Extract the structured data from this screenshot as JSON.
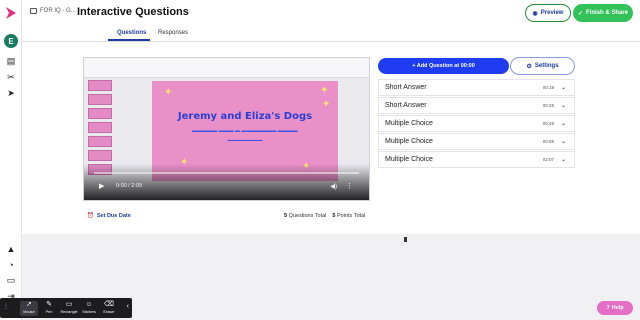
{
  "header": {
    "breadcrumb": "FOR IQ - G...",
    "title": "Interactive Questions",
    "preview_label": "Preview",
    "finish_label": "Finish & Share"
  },
  "user": {
    "avatar_initial": "E"
  },
  "tabs": [
    {
      "label": "Questions",
      "active": true
    },
    {
      "label": "Responses",
      "active": false
    }
  ],
  "video": {
    "slide_title": "Jeremy and Eliza's Dogs",
    "time": "0:00 / 2:09",
    "progress_fraction": 0.0
  },
  "footer": {
    "due_date_label": "Set Due Date",
    "questions_count": "5",
    "questions_label": "Questions Total",
    "points_count": "5",
    "points_label": "Points Total"
  },
  "actions": {
    "add_question_label": "+ Add Question at 00:00",
    "settings_label": "Settings"
  },
  "questions": [
    {
      "label": "Short Answer",
      "time": "00:19"
    },
    {
      "label": "Short Answer",
      "time": "00:28"
    },
    {
      "label": "Multiple Choice",
      "time": "00:49"
    },
    {
      "label": "Multiple Choice",
      "time": "00:59"
    },
    {
      "label": "Multiple Choice",
      "time": "02:07"
    }
  ],
  "toolbar": {
    "tools": [
      {
        "label": "Mouse",
        "icon": "cursor-icon"
      },
      {
        "label": "Pen",
        "icon": "pen-icon"
      },
      {
        "label": "Rectangle",
        "icon": "rectangle-icon"
      },
      {
        "label": "Stickers",
        "icon": "sticker-icon"
      },
      {
        "label": "Eraser",
        "icon": "eraser-icon"
      }
    ]
  },
  "help_label": "Help",
  "colors": {
    "brand_blue": "#1f3cf0",
    "finish_green": "#33c25a",
    "help_pink": "#e56ec6",
    "slide_pink": "#ea90c9"
  }
}
